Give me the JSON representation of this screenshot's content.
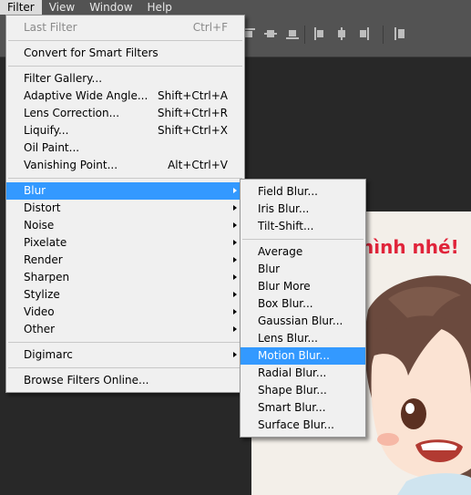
{
  "menubar": {
    "items": [
      {
        "label": "Filter",
        "active": true
      },
      {
        "label": "View"
      },
      {
        "label": "Window"
      },
      {
        "label": "Help"
      }
    ]
  },
  "filter_menu": {
    "last_filter": {
      "label": "Last Filter",
      "shortcut": "Ctrl+F"
    },
    "convert": "Convert for Smart Filters",
    "group1": [
      {
        "label": "Filter Gallery...",
        "shortcut": ""
      },
      {
        "label": "Adaptive Wide Angle...",
        "shortcut": "Shift+Ctrl+A"
      },
      {
        "label": "Lens Correction...",
        "shortcut": "Shift+Ctrl+R"
      },
      {
        "label": "Liquify...",
        "shortcut": "Shift+Ctrl+X"
      },
      {
        "label": "Oil Paint...",
        "shortcut": ""
      },
      {
        "label": "Vanishing Point...",
        "shortcut": "Alt+Ctrl+V"
      }
    ],
    "submenus": [
      "Blur",
      "Distort",
      "Noise",
      "Pixelate",
      "Render",
      "Sharpen",
      "Stylize",
      "Video",
      "Other"
    ],
    "digimarc": "Digimarc",
    "browse": "Browse Filters Online..."
  },
  "blur_menu": {
    "group1": [
      "Field Blur...",
      "Iris Blur...",
      "Tilt-Shift..."
    ],
    "group2": [
      "Average",
      "Blur",
      "Blur More",
      "Box Blur...",
      "Gaussian Blur...",
      "Lens Blur...",
      "Motion Blur...",
      "Radial Blur...",
      "Shape Blur...",
      "Smart Blur...",
      "Surface Blur..."
    ],
    "highlighted": "Motion Blur..."
  },
  "document": {
    "visible_text": "hình nhé!"
  },
  "colors": {
    "highlight": "#3399ff",
    "menu_bg": "#f0f0f0",
    "chrome": "#535353",
    "canvas_text": "#e0243a"
  }
}
